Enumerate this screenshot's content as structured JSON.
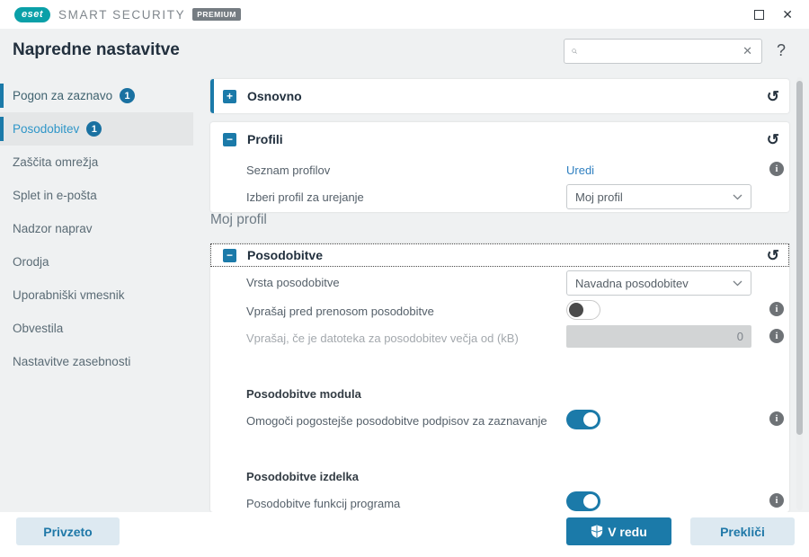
{
  "titlebar": {
    "brand": "eset",
    "product": "SMART SECURITY",
    "edition_badge": "PREMIUM"
  },
  "header": {
    "title": "Napredne nastavitve",
    "search_value": "",
    "help_label": "?"
  },
  "icons": {
    "undo": "↺",
    "close": "✕",
    "clear": "✕",
    "plus": "+",
    "minus": "−"
  },
  "sidebar": {
    "items": [
      {
        "label": "Pogon za zaznavo",
        "badge": "1"
      },
      {
        "label": "Posodobitev",
        "badge": "1",
        "selected": true
      },
      {
        "label": "Zaščita omrežja"
      },
      {
        "label": "Splet in e-pošta"
      },
      {
        "label": "Nadzor naprav"
      },
      {
        "label": "Orodja"
      },
      {
        "label": "Uporabniški vmesnik"
      },
      {
        "label": "Obvestila"
      },
      {
        "label": "Nastavitve zasebnosti"
      }
    ]
  },
  "content": {
    "osnovno": {
      "title": "Osnovno"
    },
    "profili": {
      "title": "Profili",
      "seznam_label": "Seznam profilov",
      "uredi_link": "Uredi",
      "izberi_label": "Izberi profil za urejanje",
      "profile_select_value": "Moj profil"
    },
    "profile_heading": "Moj profil",
    "posodobitve": {
      "title": "Posodobitve",
      "vrsta_label": "Vrsta posodobitve",
      "vrsta_select_value": "Navadna posodobitev",
      "ask_before_label": "Vprašaj pred prenosom posodobitve",
      "ask_before_toggle": "off",
      "ask_size_label": "Vprašaj, če je datoteka za posodobitev večja od (kB)",
      "ask_size_value": "0",
      "module_heading": "Posodobitve modula",
      "frequent_updates_label": "Omogoči pogostejše posodobitve podpisov za zaznavanje",
      "frequent_updates_toggle": "on",
      "product_heading": "Posodobitve izdelka",
      "app_updates_label": "Posodobitve funkcij programa",
      "app_updates_toggle": "on"
    }
  },
  "footer": {
    "default_label": "Privzeto",
    "ok_label": "V redu",
    "cancel_label": "Prekliči"
  },
  "colors": {
    "accent_blue": "#1b7aa9",
    "link_blue": "#2e7fc0",
    "brand_teal": "#0aa0a8",
    "title_navy": "#22303e",
    "page_bg": "#eff1f2"
  }
}
